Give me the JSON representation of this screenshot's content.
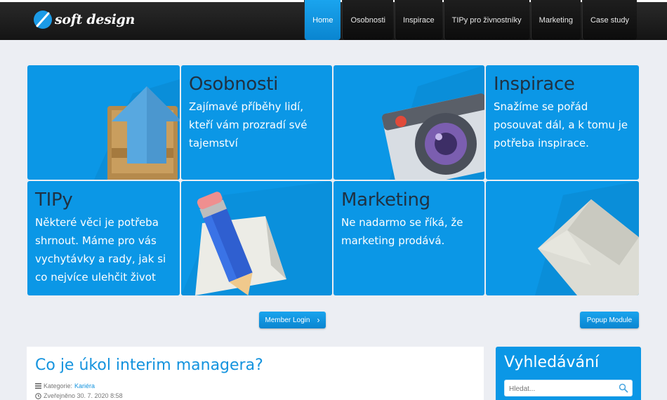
{
  "header": {
    "logo_text": "soft design",
    "nav": [
      {
        "label": "Home",
        "active": true
      },
      {
        "label": "Osobnosti"
      },
      {
        "label": "Inspirace"
      },
      {
        "label": "TIPy pro živnostníky"
      },
      {
        "label": "Marketing"
      },
      {
        "label": "Case study"
      }
    ]
  },
  "tiles": {
    "osobnosti": {
      "title": "Osobnosti",
      "desc": "Zajímavé příběhy lidí, kteří vám prozradí své tajemství"
    },
    "inspirace": {
      "title": "Inspirace",
      "desc": "Snažíme se pořád posouvat dál, a k tomu je potřeba inspirace."
    },
    "tipy": {
      "title": "TIPy",
      "desc": "Některé věci je potřeba shrnout. Máme pro vás vychytávky a rady, jak si co nejvíce ulehčit život"
    },
    "marketing": {
      "title": "Marketing",
      "desc": "Ne nadarmo se říká, že marketing prodává."
    }
  },
  "buttons": {
    "member_login": "Member Login",
    "member_login_arrow": "›",
    "popup_module": "Popup Module"
  },
  "article": {
    "title": "Co je úkol interim managera?",
    "category_label": "Kategorie:",
    "category_value": "Kariéra",
    "published": "Zveřejněno 30. 7. 2020 8:58"
  },
  "sidebar": {
    "title": "Vyhledávání",
    "search_placeholder": "Hledat..."
  },
  "colors": {
    "accent": "#0b97e6",
    "header_bg": "#1a1a1a",
    "page_bg": "#eceef3"
  }
}
